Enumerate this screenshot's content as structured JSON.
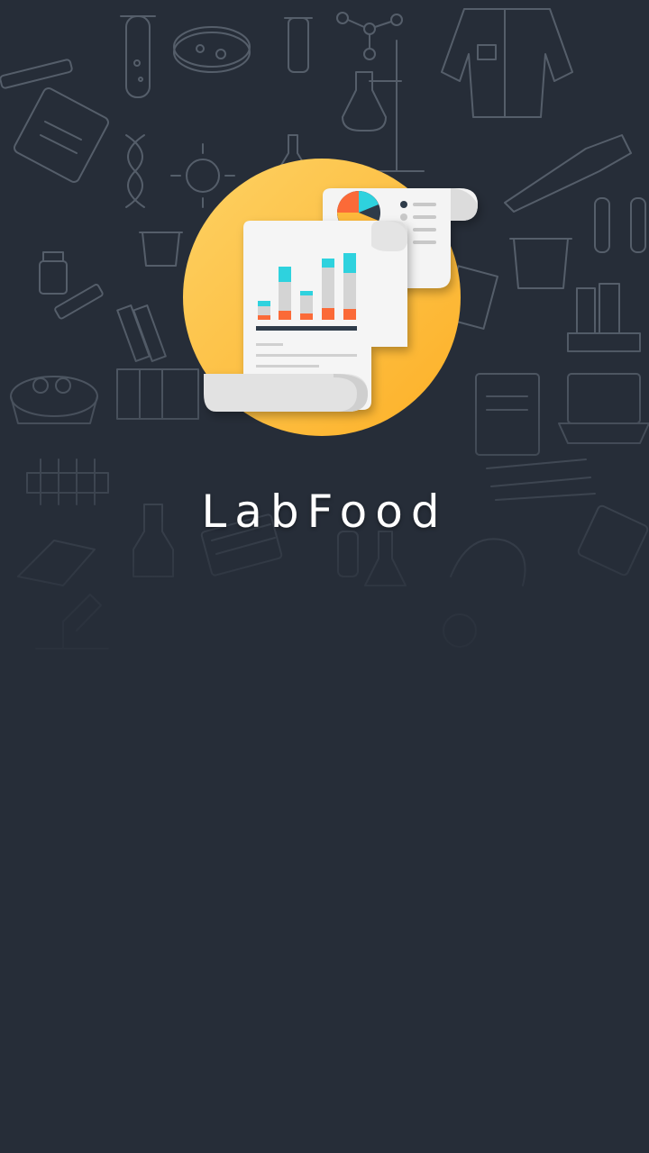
{
  "app": {
    "name": "LabFood"
  },
  "logo": {
    "icon": "report-document-icon",
    "circle_color": "#fdb93a",
    "paper_color": "#f3f3f3",
    "accent_cyan": "#2fd2de",
    "accent_orange": "#fb6a37",
    "accent_navy": "#2f3a4a"
  },
  "background": {
    "color": "#262d38",
    "pattern": "laboratory-doodles"
  }
}
